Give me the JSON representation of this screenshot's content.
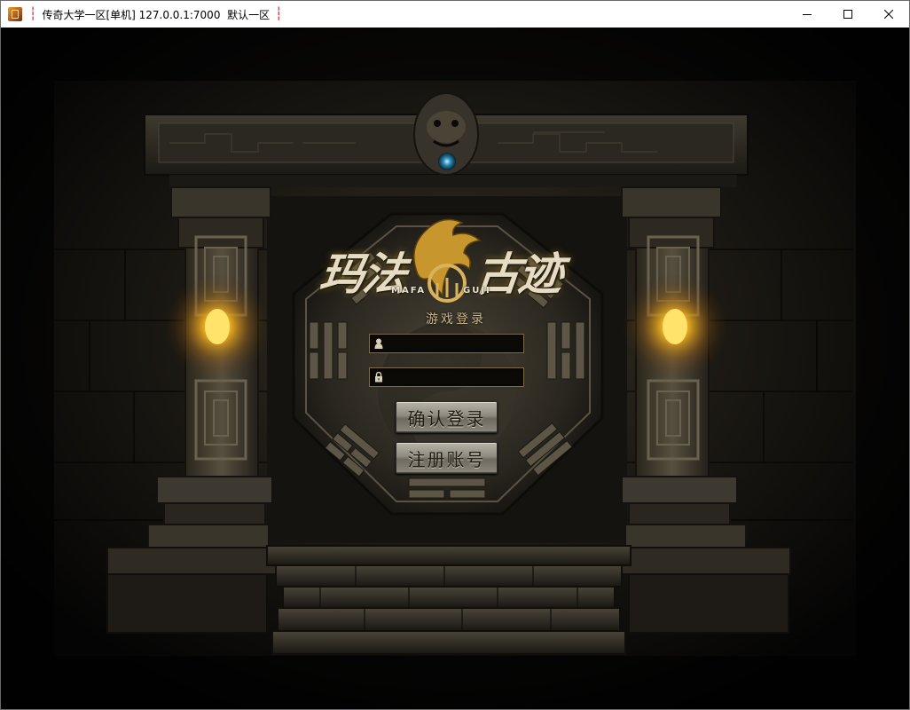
{
  "window": {
    "title": "传奇大学一区[单机] 127.0.0.1:7000  默认一区",
    "separator": "┆",
    "controls": {
      "minimize": "minimize-icon",
      "maximize": "maximize-icon",
      "close": "close-icon"
    }
  },
  "logo": {
    "left_text": "玛法",
    "right_text": "古迹",
    "sub_left": "MAFA",
    "sub_right": "GUJI"
  },
  "login": {
    "title": "游戏登录",
    "username": {
      "value": "",
      "icon": "user-icon"
    },
    "password": {
      "value": "",
      "icon": "lock-icon"
    },
    "confirm_button": "确认登录",
    "register_button": "注册账号"
  },
  "colors": {
    "lamp_glow": "#f6b51e",
    "panel_gold": "#7d6b44",
    "button_stone": "#8e8a7f"
  }
}
